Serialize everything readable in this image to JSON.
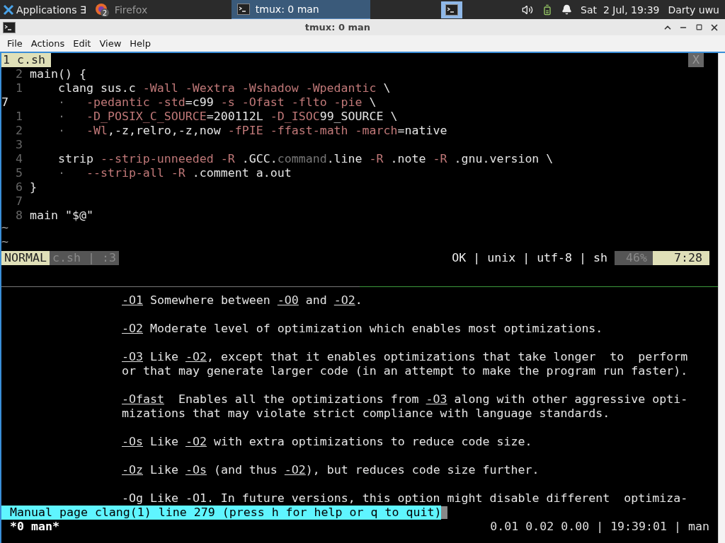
{
  "taskbar": {
    "apps_label": "Applications",
    "apps_arrow": "∃",
    "tasks": [
      {
        "label": "Firefox",
        "kind": "browser",
        "badge": "2",
        "selected": false
      },
      {
        "label": "tmux: 0 man",
        "kind": "terminal",
        "selected": true
      }
    ],
    "workspace_selected": true,
    "clock": "Sat  2 Jul, 19:39",
    "user": "Darty uwu"
  },
  "window": {
    "title": "tmux: 0 man"
  },
  "menu": [
    "File",
    "Actions",
    "Edit",
    "View",
    "Help"
  ],
  "editor": {
    "tab": "1 c.sh",
    "close": "X",
    "lines": [
      {
        "number": "2",
        "current": false,
        "segments": [
          {
            "text": "main() {",
            "kind": "plain"
          }
        ]
      },
      {
        "number": "1",
        "current": false,
        "segments": [
          {
            "text": "    clang sus.c ",
            "kind": "plain"
          },
          {
            "text": "-Wall -Wextra -Wshadow -Wpedantic",
            "kind": "flag"
          },
          {
            "text": " \\",
            "kind": "plain"
          }
        ]
      },
      {
        "number": "7",
        "current": true,
        "segments": [
          {
            "text": "    ·   ",
            "kind": "muted"
          },
          {
            "text": "-pedantic -std",
            "kind": "flag"
          },
          {
            "text": "=c99 ",
            "kind": "plain"
          },
          {
            "text": "-s -Ofast -flto -pie",
            "kind": "flag"
          },
          {
            "text": " \\",
            "kind": "plain"
          }
        ]
      },
      {
        "number": "1",
        "current": false,
        "segments": [
          {
            "text": "    ·   ",
            "kind": "muted"
          },
          {
            "text": "-D_POSIX_C_SOURCE",
            "kind": "flag"
          },
          {
            "text": "=200112L ",
            "kind": "plain"
          },
          {
            "text": "-D_ISOC",
            "kind": "flag"
          },
          {
            "text": "99_SOURCE \\",
            "kind": "plain"
          }
        ]
      },
      {
        "number": "2",
        "current": false,
        "segments": [
          {
            "text": "    ·   ",
            "kind": "muted"
          },
          {
            "text": "-Wl",
            "kind": "flag"
          },
          {
            "text": ",-z,relro,-z,now ",
            "kind": "plain"
          },
          {
            "text": "-fPIE -ffast-math -march",
            "kind": "flag"
          },
          {
            "text": "=native",
            "kind": "plain"
          }
        ]
      },
      {
        "number": "3",
        "current": false
      },
      {
        "number": "4",
        "current": false,
        "segments": [
          {
            "text": "    strip ",
            "kind": "plain"
          },
          {
            "text": "--strip-unneeded -R",
            "kind": "flag"
          },
          {
            "text": " .GCC.",
            "kind": "plain"
          },
          {
            "text": "command",
            "kind": "muted"
          },
          {
            "text": ".line ",
            "kind": "plain"
          },
          {
            "text": "-R",
            "kind": "flag"
          },
          {
            "text": " .note ",
            "kind": "plain"
          },
          {
            "text": "-R",
            "kind": "flag"
          },
          {
            "text": " .gnu.version \\",
            "kind": "plain"
          }
        ]
      },
      {
        "number": "5",
        "current": false,
        "segments": [
          {
            "text": "    ·   ",
            "kind": "muted"
          },
          {
            "text": "--strip-all -R",
            "kind": "flag"
          },
          {
            "text": " .comment a.out",
            "kind": "plain"
          }
        ]
      },
      {
        "number": "6",
        "current": false,
        "segments": [
          {
            "text": "}",
            "kind": "plain"
          }
        ]
      },
      {
        "number": "7",
        "current": false
      },
      {
        "number": "8",
        "current": false,
        "segments": [
          {
            "text": "main \"$@\"",
            "kind": "plain"
          }
        ]
      }
    ],
    "empty_markers": [
      "~",
      "~"
    ],
    "status": {
      "mode": "NORMAL",
      "file": "c.sh | :3",
      "info": "OK | unix | utf-8 | sh",
      "percent": "46%",
      "position": "7:28"
    }
  },
  "man": {
    "lines": [
      {
        "kind": "text",
        "segments": [
          {
            "text": "-O1",
            "kind": "option"
          },
          {
            "text": " Somewhere between ",
            "kind": "plain"
          },
          {
            "text": "-O0",
            "kind": "option"
          },
          {
            "text": " and ",
            "kind": "plain"
          },
          {
            "text": "-O2",
            "kind": "option"
          },
          {
            "text": ".",
            "kind": "plain"
          }
        ]
      },
      {
        "kind": "blank"
      },
      {
        "kind": "text",
        "segments": [
          {
            "text": "-O2",
            "kind": "option"
          },
          {
            "text": " Moderate level of optimization which enables most optimizations.",
            "kind": "plain"
          }
        ]
      },
      {
        "kind": "blank"
      },
      {
        "kind": "text",
        "segments": [
          {
            "text": "-O3",
            "kind": "option"
          },
          {
            "text": " Like ",
            "kind": "plain"
          },
          {
            "text": "-O2",
            "kind": "option"
          },
          {
            "text": ", except that it enables optimizations that take longer  to  perform",
            "kind": "plain"
          }
        ]
      },
      {
        "kind": "text",
        "segments": [
          {
            "text": "or that may generate larger code (in an attempt to make the program run faster).",
            "kind": "plain"
          }
        ]
      },
      {
        "kind": "blank"
      },
      {
        "kind": "text",
        "segments": [
          {
            "text": "-Ofast",
            "kind": "option"
          },
          {
            "text": "  Enables all the optimizations from ",
            "kind": "plain"
          },
          {
            "text": "-O3",
            "kind": "option"
          },
          {
            "text": " along with other aggressive opti-",
            "kind": "plain"
          }
        ]
      },
      {
        "kind": "text",
        "segments": [
          {
            "text": "mizations that may violate strict compliance with language standards.",
            "kind": "plain"
          }
        ]
      },
      {
        "kind": "blank"
      },
      {
        "kind": "text",
        "segments": [
          {
            "text": "-Os",
            "kind": "option"
          },
          {
            "text": " Like ",
            "kind": "plain"
          },
          {
            "text": "-O2",
            "kind": "option"
          },
          {
            "text": " with extra optimizations to reduce code size.",
            "kind": "plain"
          }
        ]
      },
      {
        "kind": "blank"
      },
      {
        "kind": "text",
        "segments": [
          {
            "text": "-Oz",
            "kind": "option"
          },
          {
            "text": " Like ",
            "kind": "plain"
          },
          {
            "text": "-Os",
            "kind": "option"
          },
          {
            "text": " (and thus ",
            "kind": "plain"
          },
          {
            "text": "-O2",
            "kind": "option"
          },
          {
            "text": "), but reduces code size further.",
            "kind": "plain"
          }
        ]
      },
      {
        "kind": "blank"
      },
      {
        "kind": "text",
        "segments": [
          {
            "text": "-Og Like -O1. In future versions, this option might disable different  optimiza-",
            "kind": "plain"
          }
        ]
      }
    ],
    "prompt": "Manual page clang(1) line 279 (press h for help or q to quit)"
  },
  "tmux": {
    "window": "*0 man*",
    "status": "0.01 0.02 0.00 | 19:39:01 | man"
  }
}
